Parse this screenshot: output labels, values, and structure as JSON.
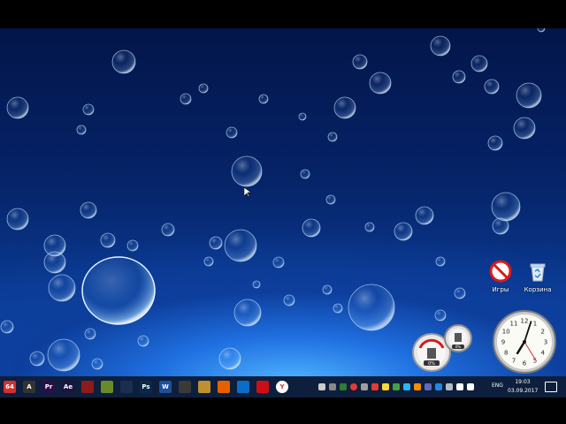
{
  "desktop": {
    "icons": [
      {
        "name": "games-shortcut",
        "label": "Игры",
        "icon": "no-entry-icon"
      },
      {
        "name": "recycle-bin",
        "label": "Корзина",
        "icon": "recycle-bin-icon"
      }
    ]
  },
  "gadgets": {
    "cpu_meter": {
      "readout": "0%"
    },
    "clock": {
      "hours": 7,
      "minutes": 3
    }
  },
  "taskbar": {
    "apps": [
      {
        "name": "aida64",
        "label": "64",
        "color": "#d32f2f"
      },
      {
        "name": "aimp",
        "label": "A",
        "color": "#333333"
      },
      {
        "name": "premiere-pro",
        "label": "Pr",
        "color": "#2a0f4a"
      },
      {
        "name": "after-effects",
        "label": "Ae",
        "color": "#1c1440"
      },
      {
        "name": "unknown-red",
        "label": "",
        "color": "#8e1b1b"
      },
      {
        "name": "fileplanet",
        "label": "",
        "color": "#6a8a2a"
      },
      {
        "name": "pen-tool",
        "label": "",
        "color": "#1a2e50"
      },
      {
        "name": "photoshop",
        "label": "Ps",
        "color": "#0a2a4a"
      },
      {
        "name": "word",
        "label": "W",
        "color": "#1e4f9c"
      },
      {
        "name": "world-of-tanks",
        "label": "",
        "color": "#3a3a3a"
      },
      {
        "name": "folder-app",
        "label": "",
        "color": "#c09030"
      },
      {
        "name": "firefox",
        "label": "",
        "color": "#e66000"
      },
      {
        "name": "edge",
        "label": "",
        "color": "#0a6ec8"
      },
      {
        "name": "opera",
        "label": "",
        "color": "#cc0f16"
      },
      {
        "name": "yandex-browser",
        "label": "Y",
        "color": "#ffffff"
      }
    ],
    "language": "ENG",
    "time": "19:03",
    "date": "03.09.2017"
  }
}
